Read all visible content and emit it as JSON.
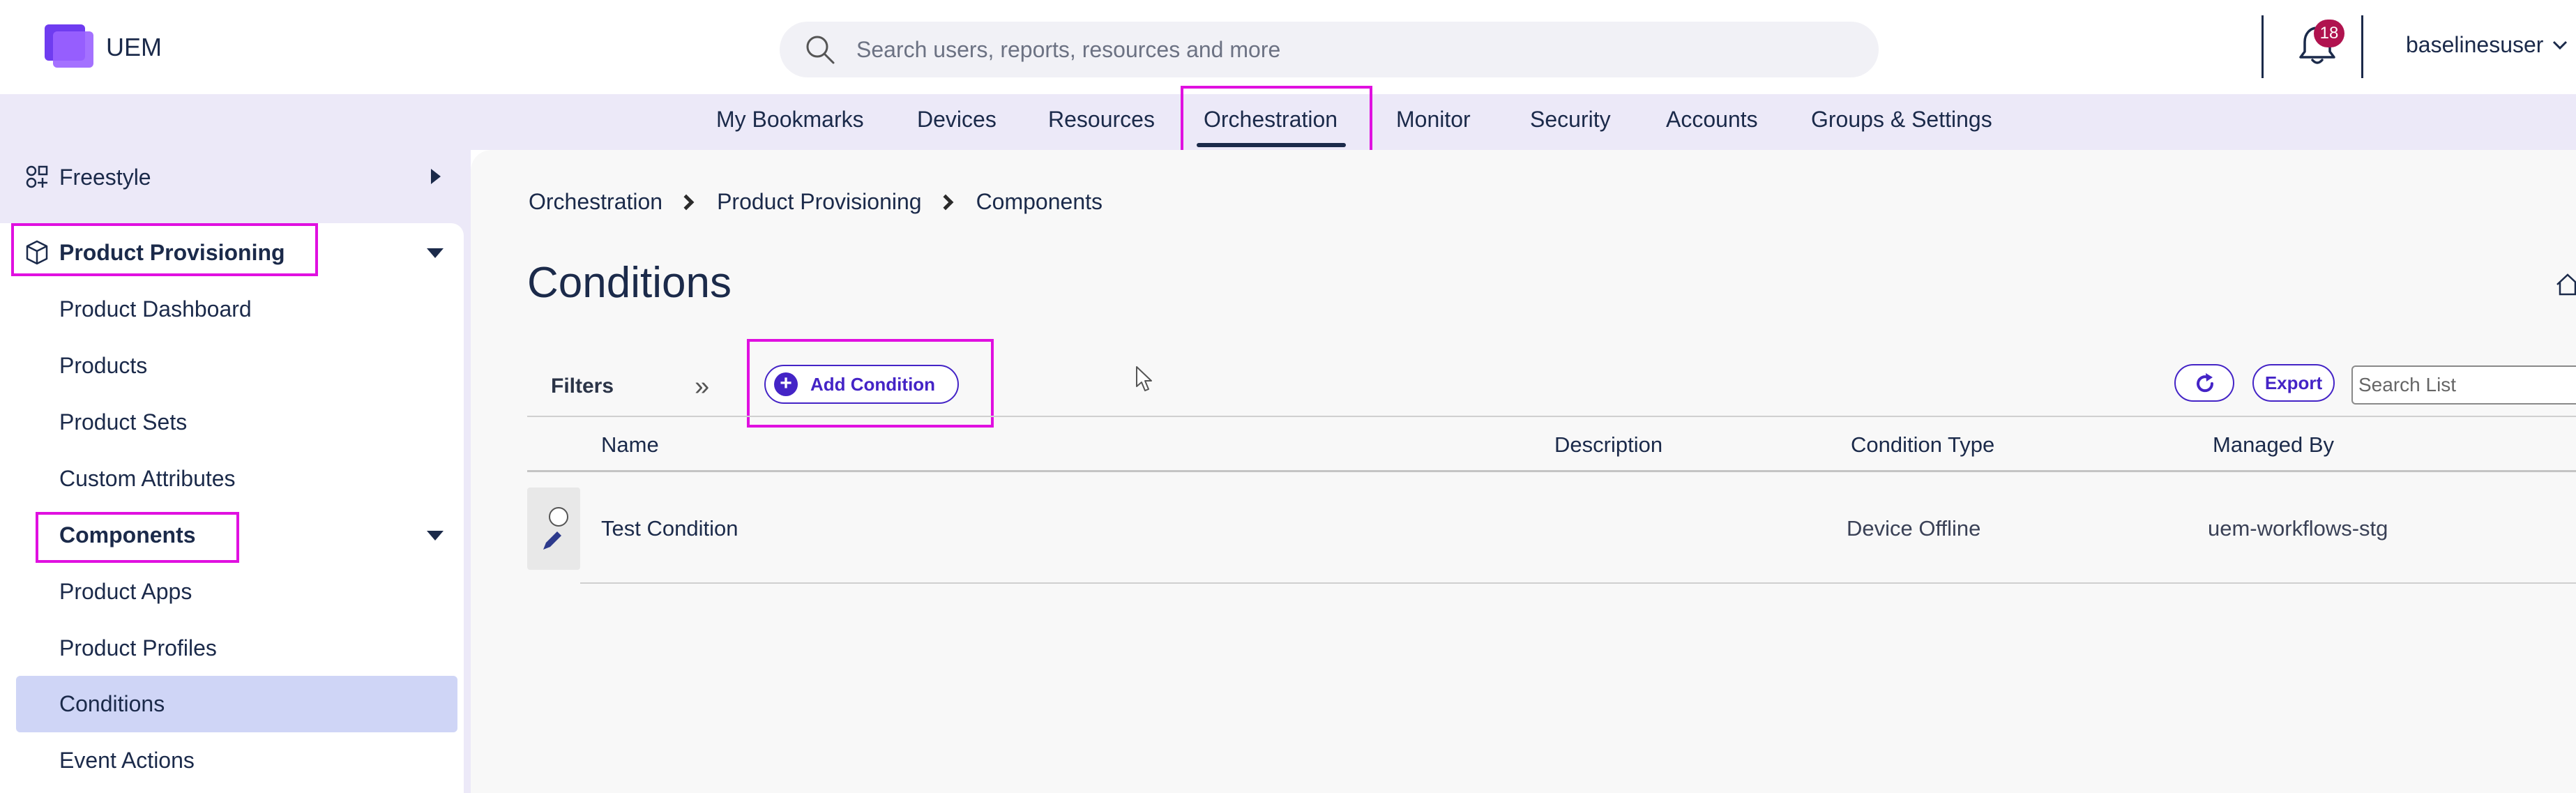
{
  "header": {
    "app_name": "UEM",
    "search_placeholder": "Search users, reports, resources and more",
    "notifications_count": "18",
    "username": "baselinesuser"
  },
  "nav": {
    "items": [
      "My Bookmarks",
      "Devices",
      "Resources",
      "Orchestration",
      "Monitor",
      "Security",
      "Accounts",
      "Groups & Settings"
    ],
    "active": "Orchestration"
  },
  "sidebar": {
    "freestyle": "Freestyle",
    "product_provisioning": "Product Provisioning",
    "items": [
      "Product Dashboard",
      "Products",
      "Product Sets",
      "Custom Attributes"
    ],
    "components": "Components",
    "component_items": [
      "Product Apps",
      "Product Profiles",
      "Conditions",
      "Event Actions"
    ],
    "active": "Conditions"
  },
  "breadcrumb": [
    "Orchestration",
    "Product Provisioning",
    "Components"
  ],
  "page": {
    "title": "Conditions"
  },
  "toolbar": {
    "filters_label": "Filters",
    "add_label": "Add Condition",
    "export_label": "Export",
    "search_placeholder": "Search List"
  },
  "table": {
    "columns": [
      "Name",
      "Description",
      "Condition Type",
      "Managed By"
    ],
    "rows": [
      {
        "name": "Test Condition",
        "description": "",
        "condition_type": "Device Offline",
        "managed_by": "uem-workflows-stg"
      }
    ]
  },
  "colors": {
    "accent": "#4424c6",
    "highlight": "#e010e0",
    "nav_bg": "#ece9f8",
    "active_item_bg": "#cfd5f6",
    "badge": "#b0134f"
  }
}
